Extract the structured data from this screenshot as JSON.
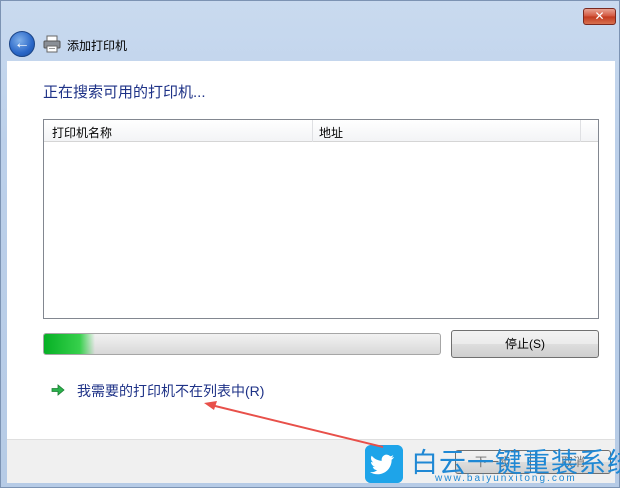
{
  "window": {
    "title": "添加打印机",
    "close_label": "✕"
  },
  "main": {
    "heading": "正在搜索可用的打印机...",
    "list_columns": [
      "打印机名称",
      "地址"
    ],
    "progress_fraction": 0.13,
    "stop_button": "停止(S)",
    "not_listed_link": "我需要的打印机不在列表中(R)"
  },
  "footer": {
    "next_button": "下一步",
    "cancel_button": "取消"
  },
  "watermark": {
    "text": "白云一键重装系统",
    "url": "www.baiyunxitong.com"
  },
  "colors": {
    "accent_text": "#1e3287",
    "progress_green": "#06b025",
    "annotation_red": "#e8504a"
  },
  "icons": {
    "back": "back-arrow-icon",
    "printer": "printer-icon",
    "link_arrow": "green-arrow-icon",
    "close": "close-icon"
  }
}
